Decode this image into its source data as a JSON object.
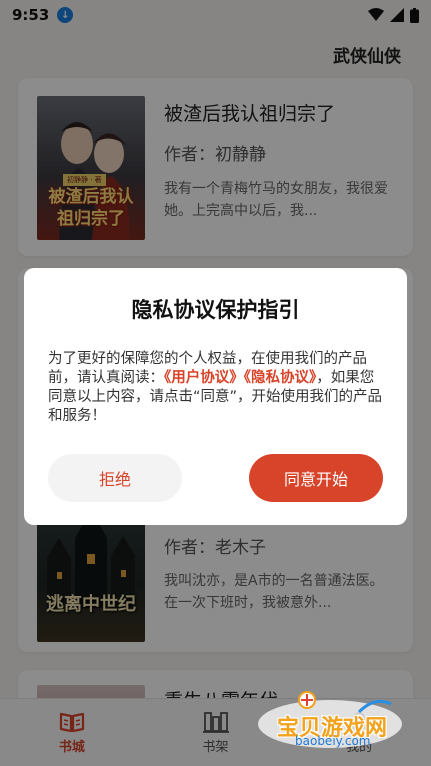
{
  "status_bar": {
    "time": "9:53"
  },
  "header": {
    "category": "武侠仙侠"
  },
  "books": [
    {
      "cover_text": "被渣后我认祖归宗了",
      "cover_author_tag": "初静静 · 著",
      "title": "被渣后我认祖归宗了",
      "author": "作者：初静静",
      "desc": "我有一个青梅竹马的女朋友，我很爱她。上完高中以后，我..."
    },
    {
      "cover_text": "逃离中世纪",
      "title": "",
      "author": "作者：老木子",
      "desc": "我叫沈亦，是A市的一名普通法医。在一次下班时，我被意外..."
    },
    {
      "title": "重生八零年代"
    }
  ],
  "dialog": {
    "title": "隐私协议保护指引",
    "body_1": "为了更好的保障您的个人权益，在使用我们的产品前，请认真阅读：",
    "link_user": "《用户协议》",
    "link_privacy": "《隐私协议》",
    "body_2": "，如果您同意以上内容，请点击“同意”，开始使用我们的产品和服务！",
    "reject_label": "拒绝",
    "agree_label": "同意开始"
  },
  "nav": {
    "items": [
      {
        "label": "书城",
        "icon": "book-open-icon"
      },
      {
        "label": "书架",
        "icon": "bookshelf-icon"
      },
      {
        "label": "我的",
        "icon": "profile-icon"
      }
    ]
  },
  "watermark": {
    "text": "宝贝游戏网",
    "url": "baobeiy.com"
  },
  "colors": {
    "accent": "#d8442a"
  }
}
